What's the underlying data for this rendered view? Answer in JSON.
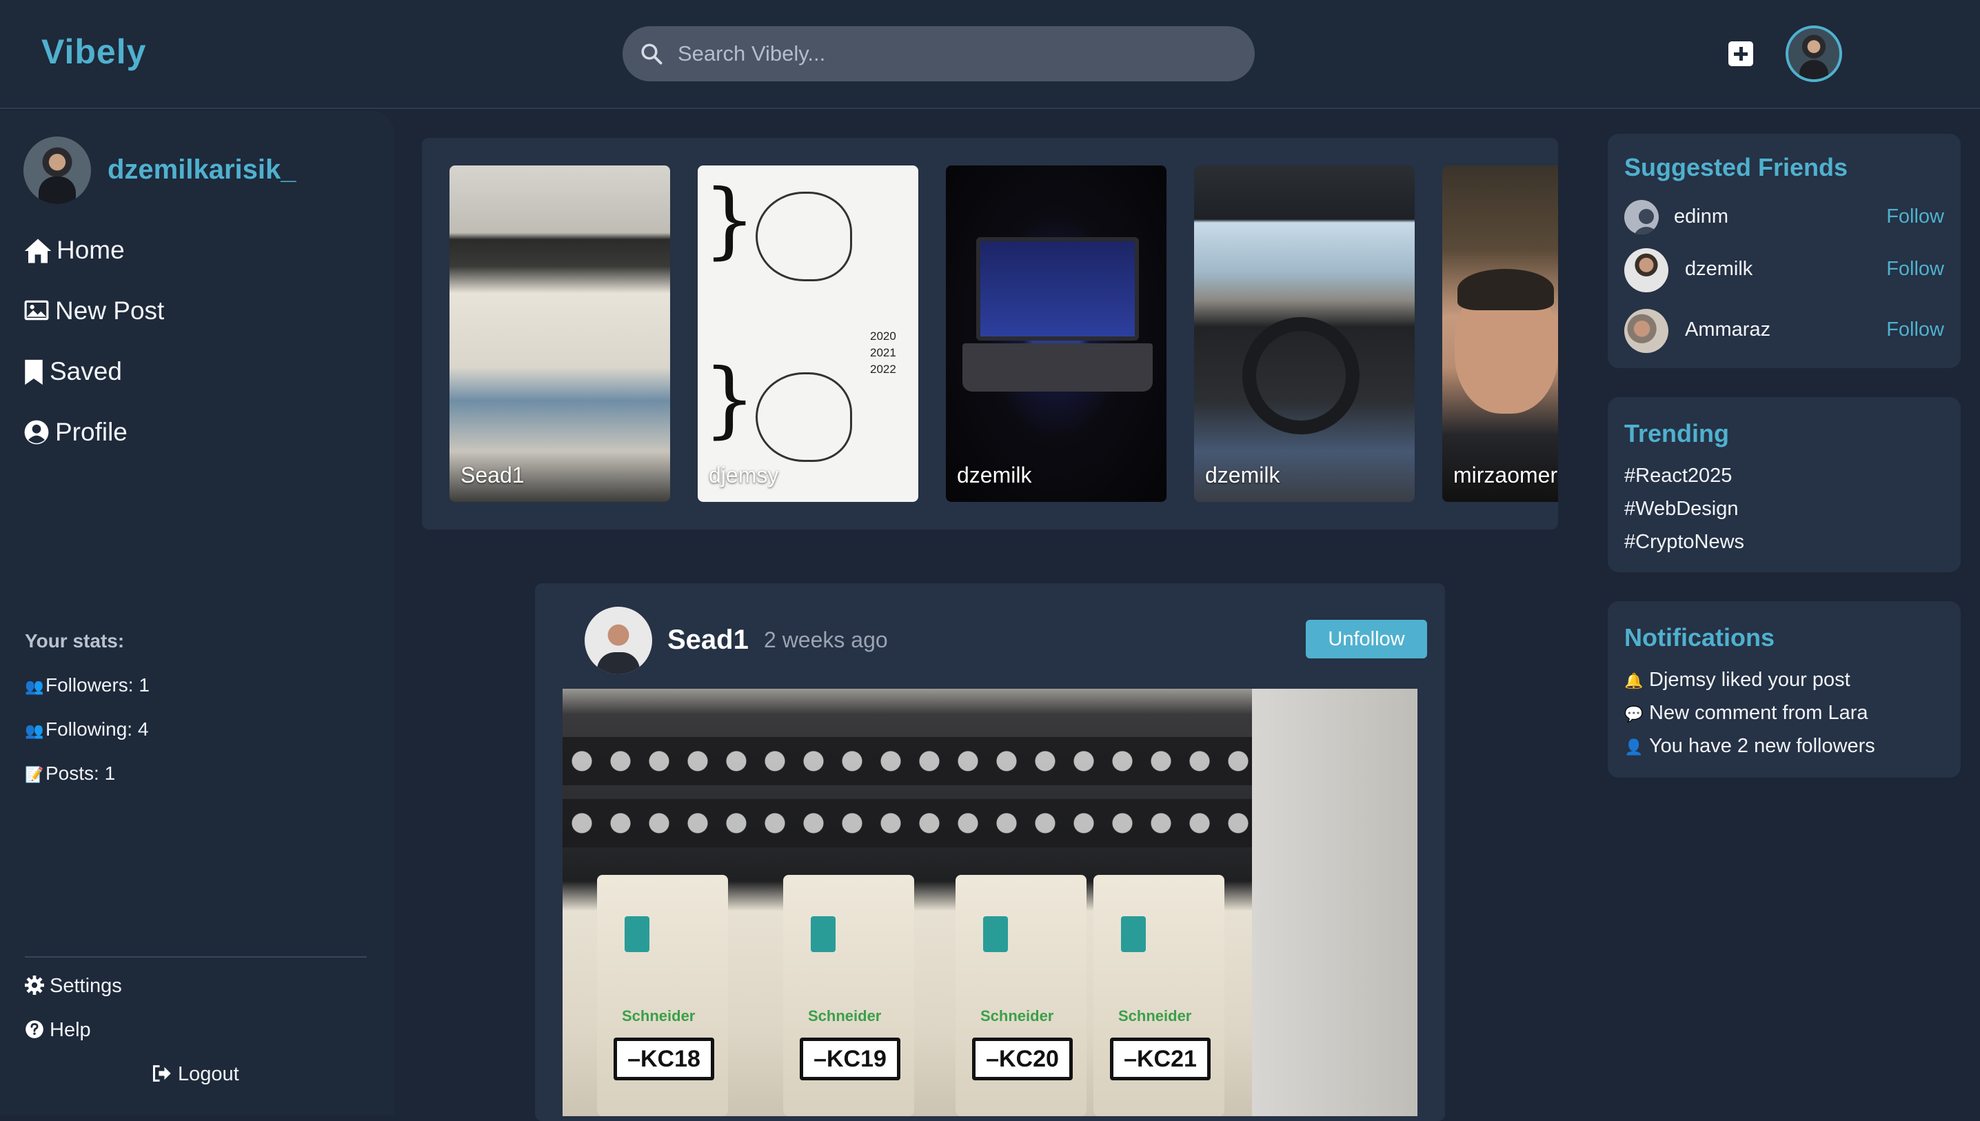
{
  "app": {
    "brand": "Vibely"
  },
  "search": {
    "placeholder": "Search Vibely..."
  },
  "user": {
    "username": "dzemilkarisik_"
  },
  "nav": [
    {
      "label": "Home",
      "icon": "home-icon"
    },
    {
      "label": "New Post",
      "icon": "image-icon"
    },
    {
      "label": "Saved",
      "icon": "bookmark-icon"
    },
    {
      "label": "Profile",
      "icon": "user-circle-icon"
    }
  ],
  "stats": {
    "title": "Your stats:",
    "followers": "Followers: 1",
    "following": "Following: 4",
    "posts": "Posts: 1"
  },
  "bottom_links": {
    "settings": "Settings",
    "help": "Help",
    "logout": "Logout"
  },
  "stories": [
    {
      "name": "Sead1"
    },
    {
      "name": "djemsy"
    },
    {
      "name": "dzemilk"
    },
    {
      "name": "dzemilk"
    },
    {
      "name": "mirzaomer"
    }
  ],
  "meme_years": {
    "top": [
      "2020",
      "2021",
      "2022"
    ]
  },
  "post": {
    "author": "Sead1",
    "time": "2 weeks ago",
    "action": "Unfollow",
    "image_tags": [
      "–KC18",
      "–KC19",
      "–KC20",
      "–KC21"
    ],
    "image_brand": "Schneider"
  },
  "suggested": {
    "title": "Suggested Friends",
    "items": [
      {
        "name": "edinm",
        "action": "Follow"
      },
      {
        "name": "dzemilk",
        "action": "Follow"
      },
      {
        "name": "Ammaraz",
        "action": "Follow"
      }
    ]
  },
  "trending": {
    "title": "Trending",
    "tags": [
      "#React2025",
      "#WebDesign",
      "#CryptoNews"
    ]
  },
  "notifications": {
    "title": "Notifications",
    "items": [
      {
        "icon": "bell-icon",
        "text": "Djemsy liked your post"
      },
      {
        "icon": "speech-bubble-icon",
        "text": "New comment from Lara"
      },
      {
        "icon": "user-icon",
        "text": "You have 2 new followers"
      }
    ]
  },
  "colors": {
    "accent": "#4fb1cf",
    "background": "#1d2636",
    "panel": "#263245"
  }
}
